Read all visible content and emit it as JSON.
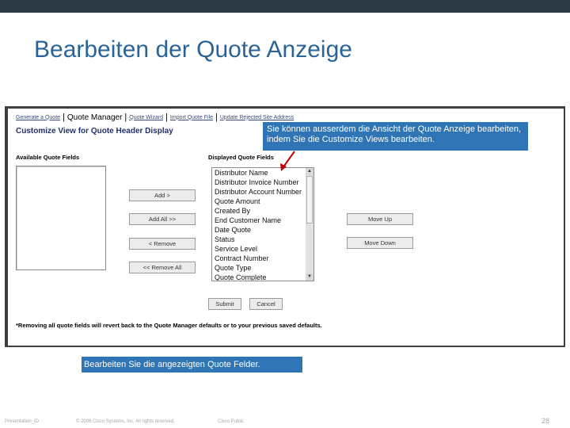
{
  "slide": {
    "title": "Bearbeiten der Quote Anzeige",
    "callout_top": "Sie können ausserdem die Ansicht der Quote Anzeige bearbeiten, indem Sie die Customize Views bearbeiten.",
    "callout_bottom": "Bearbeiten Sie die angezeigten Quote Felder.",
    "footer": {
      "presentation_id": "Presentation_ID",
      "copyright": "© 2006 Cisco Systems, Inc. All rights reserved.",
      "classification": "Cisco Public",
      "page_number": "28"
    }
  },
  "app": {
    "nav": {
      "generate_quote": "Generate a Quote",
      "quote_manager": "Quote Manager",
      "quote_wizard": "Quote Wizard",
      "import_quote_file": "Import Quote File",
      "update_rejected": "Update Rejected Site Address"
    },
    "section_title": "Customize View for Quote Header Display",
    "available_label": "Available Quote Fields",
    "displayed_label": "Displayed Quote Fields",
    "displayed_fields": [
      "Distributor Name",
      "Distributor Invoice Number",
      "Distributor Account Number",
      "Quote Amount",
      "Created By",
      "End Customer Name",
      "Date Quote",
      "Status",
      "Service Level",
      "Contract Number",
      "Quote Type",
      "Quote Complete"
    ],
    "buttons": {
      "add": "Add >",
      "add_all": "Add All >>",
      "remove": "< Remove",
      "remove_all": "<< Remove All",
      "move_up": "Move Up",
      "move_down": "Move Down",
      "submit": "Submit",
      "cancel": "Cancel"
    },
    "footnote": "*Removing all quote fields will revert back to the Quote Manager defaults or to your previous saved defaults."
  },
  "colors": {
    "title": "#2a6496",
    "callout": "#2f74b5",
    "topbar": "#2b3a43",
    "arrow": "#c00000"
  }
}
